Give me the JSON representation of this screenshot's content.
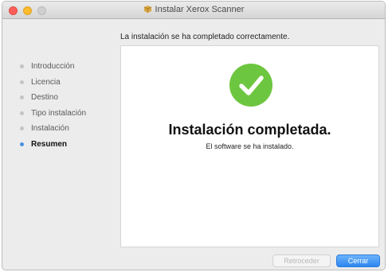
{
  "window": {
    "title": "Instalar Xerox Scanner"
  },
  "header": {
    "message": "La instalación se ha completado correctamente."
  },
  "sidebar": {
    "steps": [
      {
        "label": "Introducción",
        "active": false
      },
      {
        "label": "Licencia",
        "active": false
      },
      {
        "label": "Destino",
        "active": false
      },
      {
        "label": "Tipo instalación",
        "active": false
      },
      {
        "label": "Instalación",
        "active": false
      },
      {
        "label": "Resumen",
        "active": true
      }
    ]
  },
  "content": {
    "icon": "checkmark-icon",
    "headline": "Instalación completada.",
    "subtext": "El software se ha instalado."
  },
  "buttons": {
    "back_label": "Retroceder",
    "back_enabled": false,
    "close_label": "Cerrar"
  },
  "colors": {
    "accent": "#2d86f1",
    "success": "#6dc63f",
    "active_step_dot": "#4a90e2"
  }
}
